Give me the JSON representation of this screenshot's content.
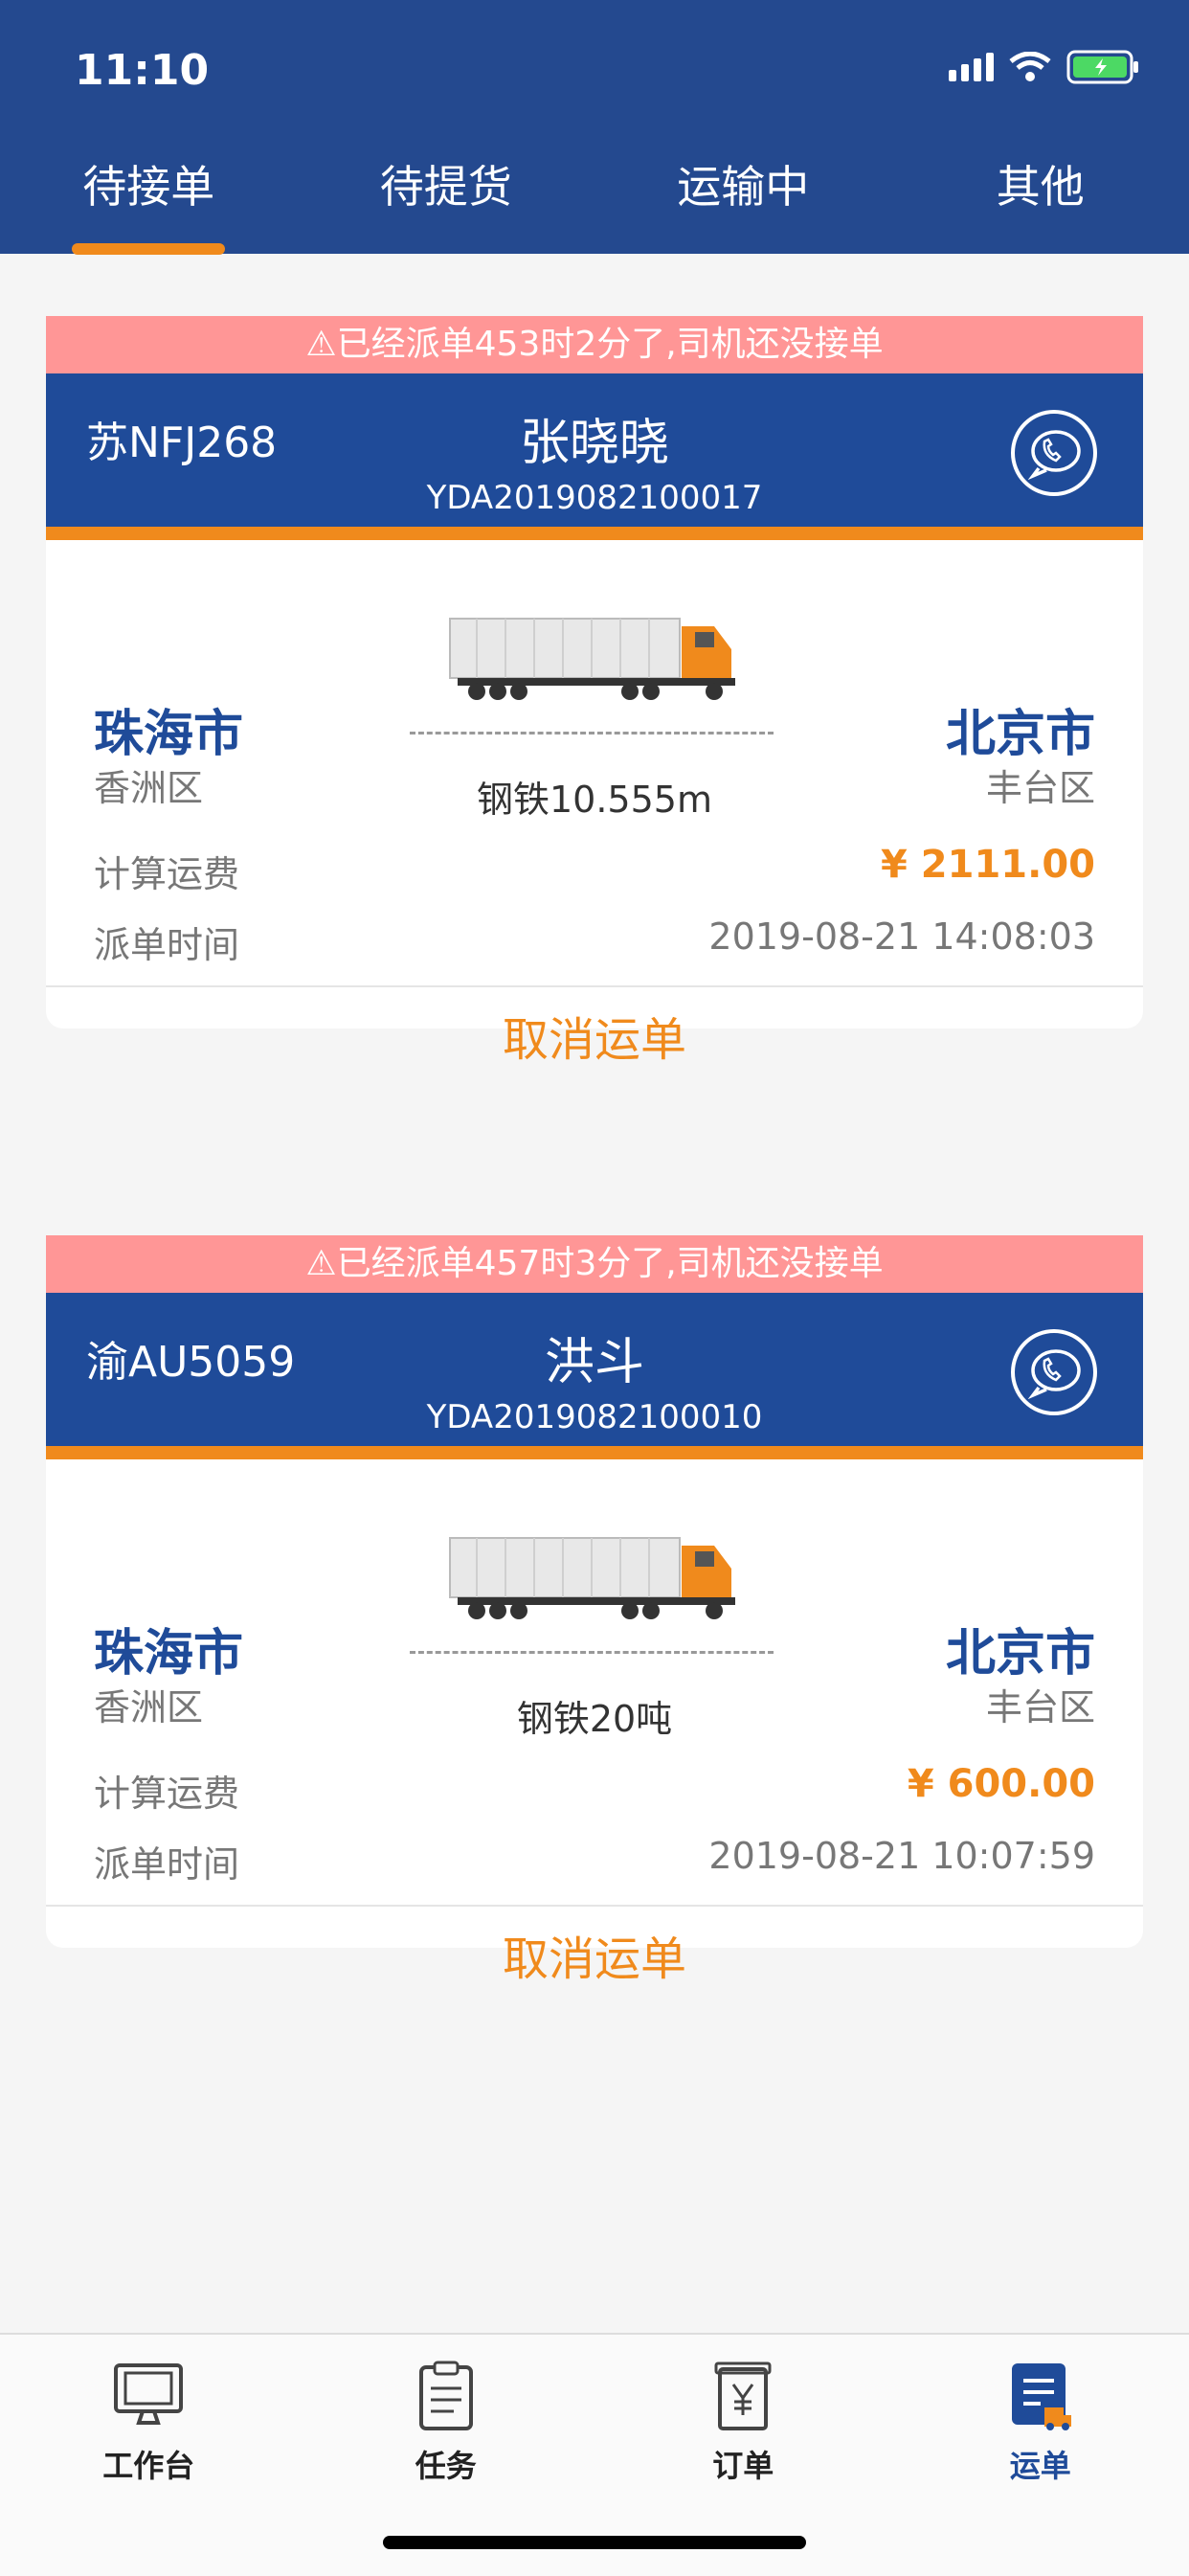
{
  "status": {
    "time": "11:10"
  },
  "tabs": [
    {
      "label": "待接单",
      "active": true
    },
    {
      "label": "待提货"
    },
    {
      "label": "运输中"
    },
    {
      "label": "其他"
    }
  ],
  "colors": {
    "primary": "#1f4b99",
    "accent": "#f08a1c",
    "warning_bg": "#ff9696"
  },
  "orders": [
    {
      "warning": "⚠已经派单453时2分了,司机还没接单",
      "plate": "苏NFJ268",
      "driver": "张晓晓",
      "order_no": "YDA2019082100017",
      "from_city": "珠海市",
      "from_district": "香洲区",
      "to_city": "北京市",
      "to_district": "丰台区",
      "cargo": "钢铁10.555m",
      "fee_label": "计算运费",
      "fee": "¥ 2111.00",
      "time_label": "派单时间",
      "dispatch_time": "2019-08-21 14:08:03",
      "cancel_label": "取消运单"
    },
    {
      "warning": "⚠已经派单457时3分了,司机还没接单",
      "plate": "渝AU5059",
      "driver": "洪斗",
      "order_no": "YDA2019082100010",
      "from_city": "珠海市",
      "from_district": "香洲区",
      "to_city": "北京市",
      "to_district": "丰台区",
      "cargo": "钢铁20吨",
      "fee_label": "计算运费",
      "fee": "¥ 600.00",
      "time_label": "派单时间",
      "dispatch_time": "2019-08-21 10:07:59",
      "cancel_label": "取消运单"
    }
  ],
  "bottom_nav": [
    {
      "label": "工作台",
      "icon": "monitor-icon"
    },
    {
      "label": "任务",
      "icon": "clipboard-icon"
    },
    {
      "label": "订单",
      "icon": "yen-receipt-icon"
    },
    {
      "label": "运单",
      "icon": "waybill-truck-icon",
      "active": true
    }
  ]
}
